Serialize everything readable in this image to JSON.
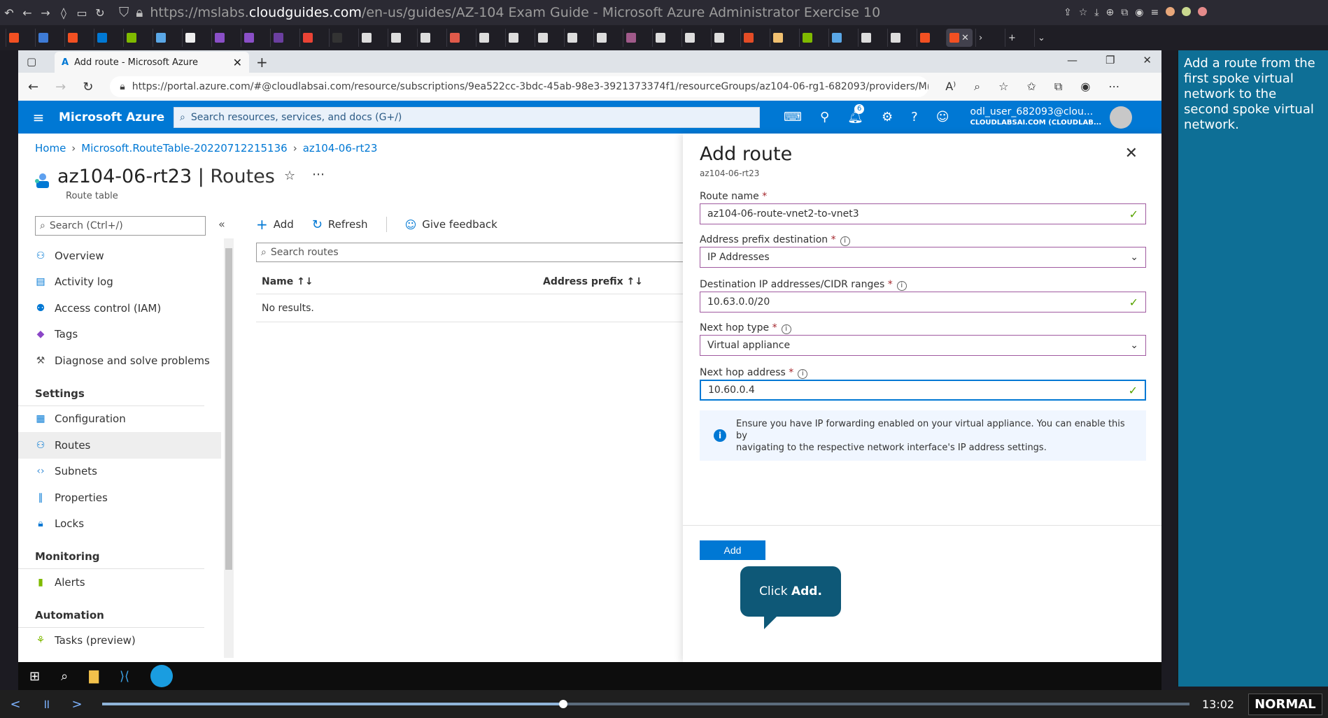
{
  "outer_browser": {
    "url_prefix": "https://mslabs.",
    "url_domain": "cloudguides.com",
    "url_rest": "/en-us/guides/AZ-104 Exam Guide - Microsoft Azure Administrator Exercise 10"
  },
  "edge": {
    "tab_title": "Add route - Microsoft Azure",
    "url": "https://portal.azure.com/#@cloudlabsai.com/resource/subscriptions/9ea522cc-3bdc-45ab-98e3-3921373374f1/resourceGroups/az104-06-rg1-682093/providers/Micr..."
  },
  "azure": {
    "brand": "Microsoft Azure",
    "search_placeholder": "Search resources, services, and docs (G+/)",
    "notifications_count": "6",
    "user_name": "odl_user_682093@clou...",
    "user_tenant": "CLOUDLABSAI.COM (CLOUDLAB..."
  },
  "breadcrumb": [
    "Home",
    "Microsoft.RouteTable-20220712215136",
    "az104-06-rt23"
  ],
  "resource": {
    "name": "az104-06-rt23",
    "section": "Routes",
    "type": "Route table"
  },
  "menu": {
    "search_placeholder": "Search (Ctrl+/)",
    "items_top": [
      "Overview",
      "Activity log",
      "Access control (IAM)",
      "Tags",
      "Diagnose and solve problems"
    ],
    "settings_header": "Settings",
    "items_settings": [
      "Configuration",
      "Routes",
      "Subnets",
      "Properties",
      "Locks"
    ],
    "monitoring_header": "Monitoring",
    "items_monitoring": [
      "Alerts"
    ],
    "automation_header": "Automation",
    "items_automation": [
      "Tasks (preview)"
    ]
  },
  "commands": {
    "add": "Add",
    "refresh": "Refresh",
    "feedback": "Give feedback"
  },
  "routes_list": {
    "search_placeholder": "Search routes",
    "col_name": "Name",
    "col_prefix": "Address prefix",
    "empty": "No results."
  },
  "panel": {
    "title": "Add route",
    "subtitle": "az104-06-rt23",
    "route_name_label": "Route name",
    "route_name_value": "az104-06-route-vnet2-to-vnet3",
    "prefix_dest_label": "Address prefix destination",
    "prefix_dest_value": "IP Addresses",
    "dest_ip_label": "Destination IP addresses/CIDR ranges",
    "dest_ip_value": "10.63.0.0/20",
    "next_hop_type_label": "Next hop type",
    "next_hop_type_value": "Virtual appliance",
    "next_hop_addr_label": "Next hop address",
    "next_hop_addr_value": "10.60.0.4",
    "info_line1": "Ensure you have IP forwarding enabled on your virtual appliance. You can enable this by",
    "info_line2": "navigating to the respective network interface's IP address settings.",
    "add_button": "Add"
  },
  "callout": {
    "prefix": "Click ",
    "bold": "Add."
  },
  "instruction": "Add a route from the first spoke virtual network to the second spoke virtual network.",
  "player": {
    "time": "13:02",
    "mode": "NORMAL",
    "progress": 0.424
  }
}
